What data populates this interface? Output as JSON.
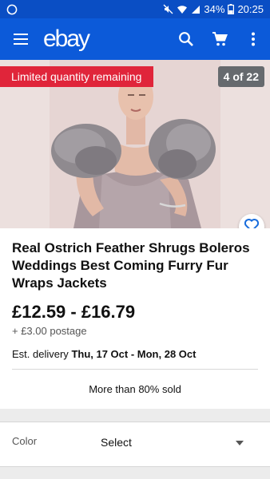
{
  "status_bar": {
    "battery": "34%",
    "time": "20:25"
  },
  "header": {
    "logo": "ebay",
    "icons": [
      "menu-icon",
      "search-icon",
      "cart-icon",
      "more-vert-icon"
    ]
  },
  "gallery": {
    "badge": "Limited quantity remaining",
    "counter": "4 of 22"
  },
  "listing": {
    "title": "Real Ostrich Feather Shrugs Boleros Weddings Best Coming Furry Fur Wraps Jackets",
    "price": "£12.59 - £16.79",
    "postage": "+ £3.00 postage",
    "delivery_label": "Est. delivery",
    "delivery_dates": "Thu, 17 Oct - Mon, 28 Oct",
    "sold": "More than 80% sold"
  },
  "options": {
    "label": "Color",
    "value": "Select"
  },
  "colors": {
    "header_blue": "#0c5ad9",
    "badge_red": "#e0253a",
    "accent_blue": "#1a6ddc"
  }
}
